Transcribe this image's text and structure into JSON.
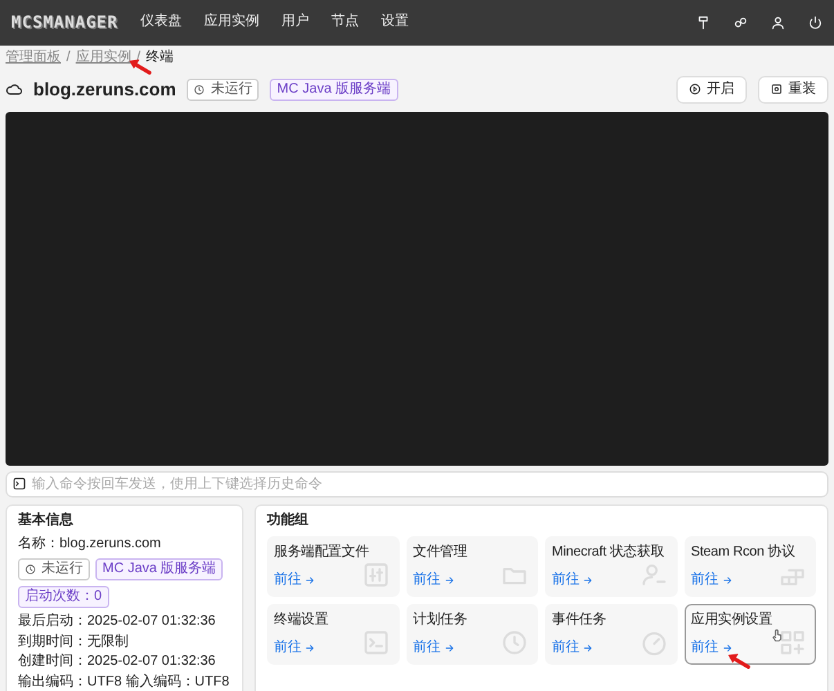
{
  "navbar": {
    "logo": "MCSMANAGER",
    "menu": [
      "仪表盘",
      "应用实例",
      "用户",
      "节点",
      "设置"
    ]
  },
  "breadcrumb": {
    "separator": "/",
    "items": [
      "管理面板",
      "应用实例",
      "终端"
    ]
  },
  "instance": {
    "name": "blog.zeruns.com",
    "status": "未运行",
    "type": "MC Java 版服务端"
  },
  "actions": [
    {
      "label": "开启",
      "kind": "start"
    },
    {
      "label": "重装",
      "kind": "reinstall"
    }
  ],
  "terminal": {
    "placeholder": "输入命令按回车发送，使用上下键选择历史命令"
  },
  "basic_info": {
    "title": "基本信息",
    "name": "名称：blog.zeruns.com",
    "badges": [
      {
        "text": "未运行",
        "kind": "status"
      },
      {
        "text": "MC Java 版服务端",
        "kind": "type"
      },
      {
        "text": "启动次数：0",
        "kind": "count"
      }
    ],
    "rows": [
      "最后启动：2025-02-07 01:32:36",
      "到期时间：无限制",
      "创建时间：2025-02-07 01:32:36",
      "输出编码：UTF8 输入编码：UTF8"
    ]
  },
  "features": {
    "title": "功能组",
    "items": [
      {
        "title": "服务端配置文件",
        "link": "前往",
        "kind": "config",
        "hovered": false
      },
      {
        "title": "文件管理",
        "link": "前往",
        "kind": "files",
        "hovered": false
      },
      {
        "title": "Minecraft 状态获取",
        "link": "前往",
        "kind": "status",
        "hovered": false
      },
      {
        "title": "Steam Rcon 协议",
        "link": "前往",
        "kind": "rcon",
        "hovered": false
      },
      {
        "title": "终端设置",
        "link": "前往",
        "kind": "terminal",
        "hovered": false
      },
      {
        "title": "计划任务",
        "link": "前往",
        "kind": "schedule",
        "hovered": false
      },
      {
        "title": "事件任务",
        "link": "前往",
        "kind": "event",
        "hovered": false
      },
      {
        "title": "应用实例设置",
        "link": "前往",
        "kind": "settings",
        "hovered": true
      }
    ]
  }
}
